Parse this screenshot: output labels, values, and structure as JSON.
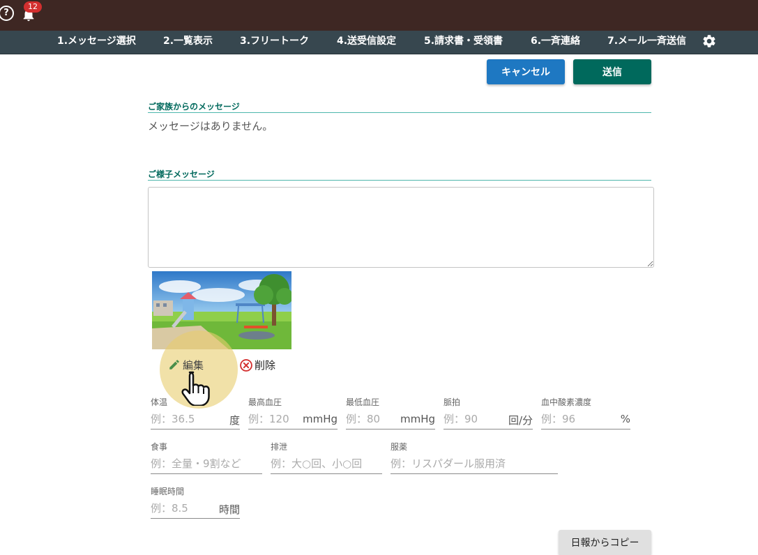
{
  "header": {
    "notification_count": "12",
    "help_icon": "?",
    "colors": {
      "topbar": "#3e2723",
      "navbar": "#37474f",
      "badge": "#d32f2f"
    }
  },
  "nav": {
    "items": [
      "1.メッセージ選択",
      "2.一覧表示",
      "3.フリートーク",
      "4.送受信設定",
      "5.請求書・受領書",
      "6.一斉連絡",
      "7.メール一斉送信"
    ]
  },
  "actions": {
    "cancel_label": "キャンセル",
    "send_label": "送信",
    "colors": {
      "cancel": "#1e78c2",
      "send": "#00695c"
    }
  },
  "family_message": {
    "title": "ご家族からのメッセージ",
    "body": "メッセージはありません。"
  },
  "status_message": {
    "title": "ご様子メッセージ",
    "value": ""
  },
  "photo": {
    "edit_label": "編集",
    "delete_label": "削除"
  },
  "vitals": {
    "temperature": {
      "label": "体温",
      "placeholder": "例：36.5",
      "unit": "度"
    },
    "bp_high": {
      "label": "最高血圧",
      "placeholder": "例：120",
      "unit": "mmHg"
    },
    "bp_low": {
      "label": "最低血圧",
      "placeholder": "例：80",
      "unit": "mmHg"
    },
    "pulse": {
      "label": "脈拍",
      "placeholder": "例：90",
      "unit": "回/分"
    },
    "spo2": {
      "label": "血中酸素濃度",
      "placeholder": "例：96",
      "unit": "%"
    },
    "meal": {
      "label": "食事",
      "placeholder": "例：全量・9割など"
    },
    "excretion": {
      "label": "排泄",
      "placeholder": "例：大○回、小○回"
    },
    "medication": {
      "label": "服薬",
      "placeholder": "例：リスパダール服用済"
    },
    "sleep": {
      "label": "睡眠時間",
      "placeholder": "例：8.5",
      "unit": "時間"
    }
  },
  "copy_label": "日報からコピー"
}
